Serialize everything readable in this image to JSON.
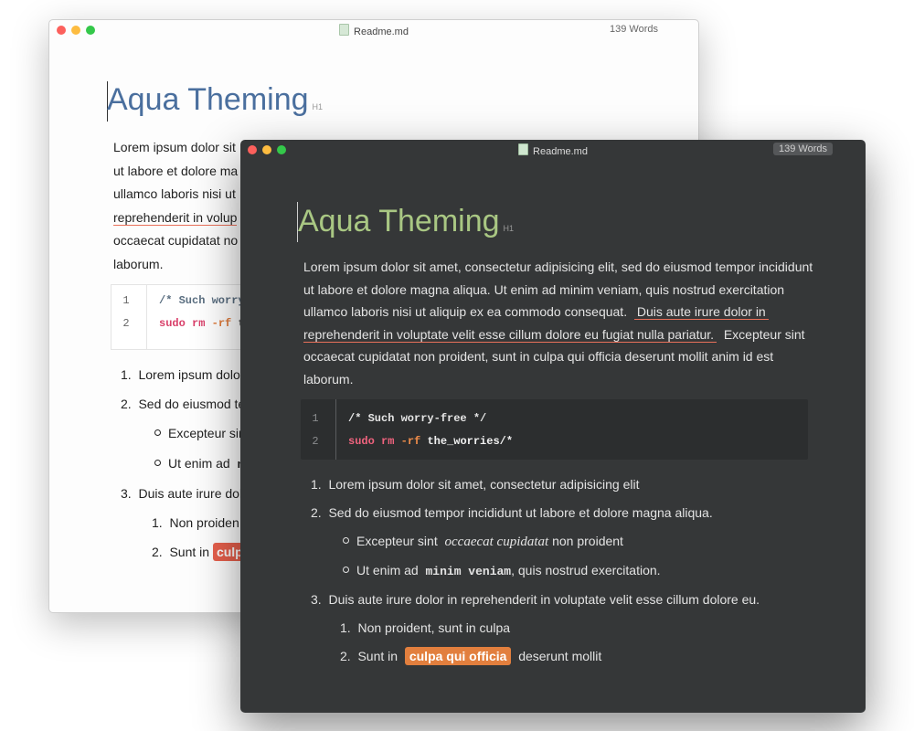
{
  "light": {
    "title": "Readme.md",
    "word_count": "139 Words",
    "heading": "Aqua Theming",
    "heading_tag": "H1",
    "para_lines": [
      "Lorem ipsum dolor sit",
      "ut labore et dolore ma",
      "ullamco laboris nisi ut",
      "reprehenderit in volup",
      "occaecat cupidatat no",
      "laborum."
    ],
    "code": {
      "ln1": "1",
      "ln2": "2",
      "line1_comment": "/* Such worry",
      "line2_kw": "sudo",
      "line2_space": " ",
      "line2_rm": "rm",
      "line2_flag": "-rf",
      "line2_rest": "t"
    },
    "list": {
      "n1": "1.",
      "item1": "Lorem ipsum dolo",
      "n2": "2.",
      "item2": "Sed do eiusmod te",
      "sub1": "Excepteur sir",
      "sub2_a": "Ut enim ad",
      "sub2_b": "n",
      "n3": "3.",
      "item3": "Duis aute irure dol",
      "sub3_n1": "1.",
      "sub3_1": "Non proiden",
      "sub3_n2": "2.",
      "sub3_2": "Sunt in",
      "sub3_hl": "culp"
    }
  },
  "dark": {
    "title": "Readme.md",
    "word_count": "139 Words",
    "heading": "Aqua Theming",
    "heading_tag": "H1",
    "para": {
      "line1": "Lorem ipsum dolor sit amet, consectetur adipisicing elit, sed do eiusmod tempor incididunt",
      "line2": "ut labore et dolore magna aliqua. Ut enim ad minim veniam, quis nostrud exercitation",
      "line3_a": "ullamco laboris nisi ut aliquip ex ea commodo consequat.",
      "line3_u": "Duis aute irure dolor in",
      "line4_u": "reprehenderit in voluptate velit esse cillum dolore eu fugiat nulla pariatur.",
      "line4_b": "Excepteur sint",
      "line5": "occaecat cupidatat non proident, sunt in culpa qui officia deserunt mollit anim id est",
      "line6": "laborum."
    },
    "code": {
      "ln1": "1",
      "ln2": "2",
      "line1_comment": "/* Such worry-free */",
      "line2_kw": "sudo",
      "line2_space": " ",
      "line2_rm": "rm",
      "line2_flag": "-rf",
      "line2_rest": "the_worries/*"
    },
    "list": {
      "n1": "1.",
      "item1": "Lorem ipsum dolor sit amet, consectetur adipisicing elit",
      "n2": "2.",
      "item2": "Sed do eiusmod tempor incididunt ut labore et dolore magna aliqua.",
      "sub1_a": "Excepteur sint",
      "sub1_i": "occaecat cupidatat",
      "sub1_b": "non proident",
      "sub2_a": "Ut enim ad",
      "sub2_m": "minim veniam",
      "sub2_b": ", quis nostrud exercitation.",
      "n3": "3.",
      "item3": "Duis aute irure dolor in reprehenderit in voluptate velit esse cillum dolore eu.",
      "sub3_n1": "1.",
      "sub3_1": "Non proident, sunt in culpa",
      "sub3_n2": "2.",
      "sub3_2a": "Sunt in",
      "sub3_hl": "culpa qui officia",
      "sub3_2b": "deserunt mollit"
    }
  },
  "colors": {
    "light_heading": "#4a6f9e",
    "dark_heading": "#a9c783",
    "underline": "#e9705a",
    "light_highlight": "#e8604c",
    "dark_highlight": "#e27f3e",
    "dark_bg": "#353738"
  }
}
